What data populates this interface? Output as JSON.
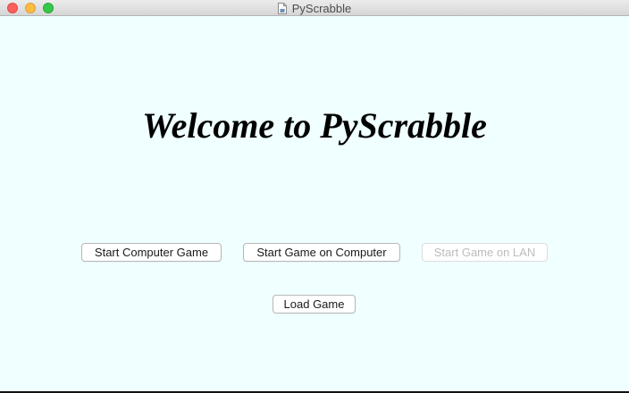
{
  "window": {
    "title": "PyScrabble",
    "controls": {
      "close": "close-button",
      "minimize": "minimize-button",
      "zoom": "zoom-button"
    },
    "title_icon": "document-icon"
  },
  "main": {
    "heading": "Welcome to PyScrabble",
    "buttons": {
      "start_computer_game": "Start Computer Game",
      "start_game_on_computer": "Start Game on Computer",
      "start_game_on_lan": "Start Game on LAN",
      "load_game": "Load Game"
    },
    "disabled": [
      "start_game_on_lan"
    ]
  },
  "colors": {
    "background": "#f0ffff",
    "close": "#fc605c",
    "minimize": "#fdbc40",
    "zoom": "#34c84a",
    "disabled_text": "#bcbcbc"
  }
}
